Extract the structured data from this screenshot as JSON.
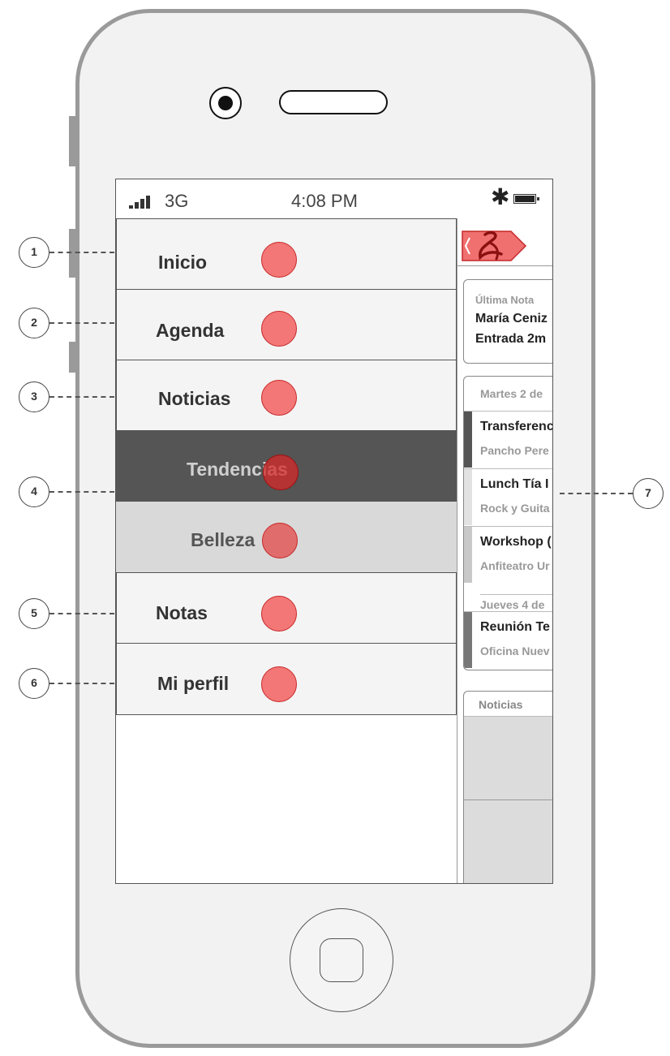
{
  "status_bar": {
    "network": "3G",
    "time": "4:08 PM"
  },
  "menu": {
    "items": [
      {
        "label": "Inicio"
      },
      {
        "label": "Agenda"
      },
      {
        "label": "Noticias"
      },
      {
        "label": "Tendencias",
        "state": "selected"
      },
      {
        "label": "Belleza",
        "state": "sub-item"
      },
      {
        "label": "Notas"
      },
      {
        "label": "Mi perfil"
      }
    ]
  },
  "right_panel": {
    "last_note": {
      "heading": "Última Nota",
      "line1": "María Ceniz",
      "line2": "Entrada 2m"
    },
    "agenda": {
      "day1": "Martes 2 de",
      "events_day1": [
        {
          "title": "Transferenc",
          "subtitle": "Pancho Pere"
        },
        {
          "title": "Lunch Tía I",
          "subtitle": "Rock y Guita"
        },
        {
          "title": "Workshop (",
          "subtitle": "Anfiteatro Ur"
        }
      ],
      "day2": "Jueves 4 de",
      "events_day2": [
        {
          "title": "Reunión Te",
          "subtitle": "Oficina Nuev"
        }
      ]
    },
    "news": {
      "heading": "Noticias"
    }
  },
  "annotations": [
    "1",
    "2",
    "3",
    "4",
    "5",
    "6",
    "7"
  ],
  "colors": {
    "accent_red": "#f45c5c",
    "selected_bg": "#555555",
    "subitem_bg": "#d9d9d9",
    "frame": "#9a9a9a"
  },
  "icons": [
    "signal-icon",
    "bluetooth-icon",
    "battery-icon",
    "back-chevron-icon",
    "brand-logo-icon"
  ]
}
